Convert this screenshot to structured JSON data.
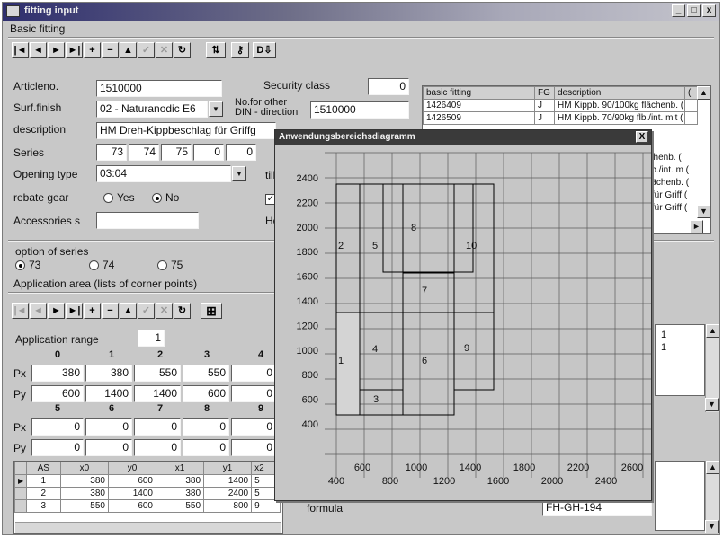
{
  "window": {
    "title": "fitting input",
    "controls": [
      "_",
      "□",
      "x"
    ]
  },
  "basic_fitting": {
    "group_label": "Basic fitting",
    "nav": [
      "|◄",
      "◄",
      "►",
      "►|",
      "+",
      "−",
      "▲",
      "✓",
      "✕",
      "↻"
    ],
    "articleno_label": "Articleno.",
    "articleno_value": "1510000",
    "surfinish_label": "Surf.finish",
    "surfinish_value": "02 - Naturanodic E6",
    "description_label": "description",
    "description_value": "HM Dreh-Kippbeschlag für Griffg",
    "series_label": "Series",
    "series_values": [
      "73",
      "74",
      "75",
      "0",
      "0"
    ],
    "opening_type_label": "Opening type",
    "opening_type_value": "03:04",
    "rebate_gear_label": "rebate gear",
    "rebate_yes": "Yes",
    "rebate_no": "No",
    "accessories_label": "Accessories s",
    "security_class_label": "Security class",
    "security_class_value": "0",
    "no_other_din_label_1": "No.for other",
    "no_other_din_label_2": "DIN - direction",
    "no_other_din_value": "1510000",
    "till_label": "till",
    "ho_label": "Ho"
  },
  "fitting_table": {
    "headers": [
      "basic fitting",
      "FG",
      "description",
      "("
    ],
    "rows": [
      [
        "1426409",
        "J",
        "HM Kippb. 90/100kg flächenb. (",
        ""
      ],
      [
        "1426509",
        "J",
        "HM Kippb. 70/90kg flb./int. mit (",
        ""
      ],
      [
        "",
        "",
        "flächenb. (",
        ""
      ],
      [
        "",
        "",
        "g flb./int. m (",
        ""
      ],
      [
        "",
        "",
        "g flächenb. (",
        ""
      ],
      [
        "",
        "",
        "ag für Griff (",
        ""
      ],
      [
        "",
        "",
        "ag für Griff (",
        ""
      ]
    ]
  },
  "series_options": {
    "label": "option of series",
    "options": [
      "73",
      "74",
      "75"
    ],
    "selected": "73"
  },
  "application_area": {
    "label": "Application area (lists of corner points)",
    "range_label": "Application range",
    "range_value": "1",
    "indices_top": [
      "0",
      "1",
      "2",
      "3",
      "4"
    ],
    "px_label": "Px",
    "py_label": "Py",
    "px_top": [
      "380",
      "380",
      "550",
      "550",
      "0"
    ],
    "py_top": [
      "600",
      "1400",
      "1400",
      "600",
      "0"
    ],
    "indices_bottom": [
      "5",
      "6",
      "7",
      "8",
      "9"
    ],
    "px_bottom": [
      "0",
      "0",
      "0",
      "0",
      "0"
    ],
    "py_bottom": [
      "0",
      "0",
      "0",
      "0",
      "0"
    ]
  },
  "points_table": {
    "headers": [
      "AS",
      "x0",
      "y0",
      "x1",
      "y1",
      "x2"
    ],
    "rows": [
      [
        "1",
        "380",
        "600",
        "380",
        "1400",
        "5"
      ],
      [
        "2",
        "380",
        "1400",
        "380",
        "2400",
        "5"
      ],
      [
        "3",
        "550",
        "600",
        "550",
        "800",
        "9"
      ]
    ]
  },
  "right_lower": {
    "list_values": [
      "1",
      "1"
    ],
    "formula_label": "formula",
    "formula_value": "FH-GH-194"
  },
  "diagram": {
    "title": "Anwendungsbereichsdiagramm",
    "close": "X",
    "y_ticks": [
      "2400",
      "2200",
      "2000",
      "1800",
      "1600",
      "1400",
      "1200",
      "1000",
      "800",
      "600",
      "400"
    ],
    "x_ticks_upper": [
      "600",
      "1000",
      "1400",
      "1800",
      "2200",
      "2600"
    ],
    "x_ticks_lower": [
      "400",
      "800",
      "1200",
      "1600",
      "2000",
      "2400"
    ],
    "regions": [
      "1",
      "2",
      "3",
      "4",
      "5",
      "6",
      "7",
      "8",
      "9",
      "10"
    ]
  }
}
